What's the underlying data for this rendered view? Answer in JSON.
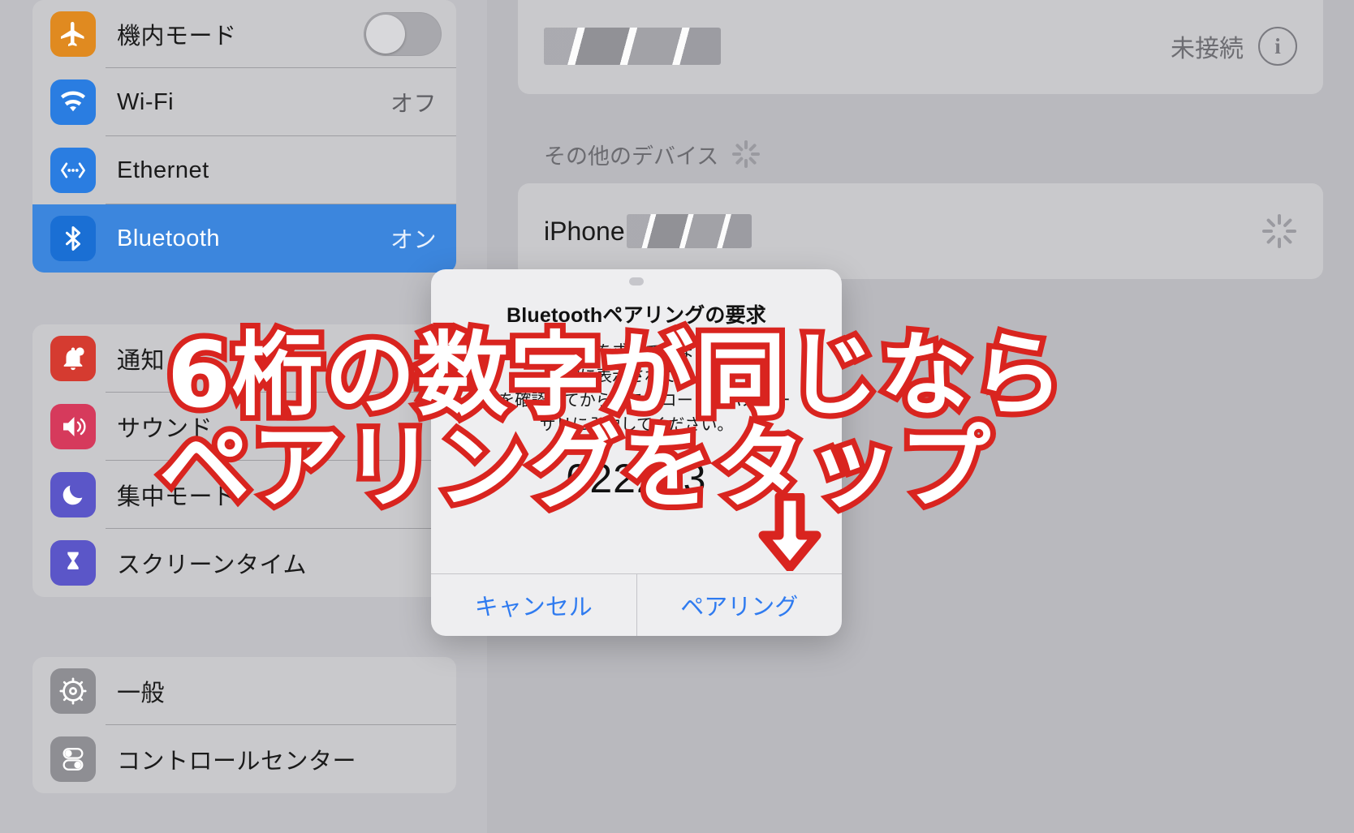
{
  "app": {
    "name": "iPadOS Settings",
    "accent_blue": "#3c86dd",
    "annotation_red": "#d9241f"
  },
  "sidebar": {
    "groups": [
      {
        "name": "connectivity",
        "items": [
          {
            "label": "機内モード",
            "icon": "airplane-icon",
            "control": "toggle",
            "toggle_on": false,
            "value": ""
          },
          {
            "label": "Wi-Fi",
            "icon": "wifi-icon",
            "control": "value",
            "value": "オフ"
          },
          {
            "label": "Ethernet",
            "icon": "ethernet-icon",
            "control": "none",
            "value": ""
          },
          {
            "label": "Bluetooth",
            "icon": "bluetooth-icon",
            "control": "value",
            "value": "オン",
            "selected": true
          }
        ]
      },
      {
        "name": "system-prefs",
        "items": [
          {
            "label": "通知",
            "icon": "bell-icon",
            "control": "none",
            "value": ""
          },
          {
            "label": "サウンド",
            "icon": "speaker-icon",
            "control": "none",
            "value": ""
          },
          {
            "label": "集中モード",
            "icon": "moon-icon",
            "control": "none",
            "value": ""
          },
          {
            "label": "スクリーンタイム",
            "icon": "hourglass-icon",
            "control": "none",
            "value": ""
          }
        ]
      },
      {
        "name": "general",
        "items": [
          {
            "label": "一般",
            "icon": "gear-icon",
            "control": "none",
            "value": ""
          },
          {
            "label": "コントロールセンター",
            "icon": "control-center-icon",
            "control": "none",
            "value": ""
          }
        ]
      }
    ]
  },
  "detail": {
    "paired_device": {
      "name_redacted": true,
      "status": "未接続",
      "info_glyph": "i"
    },
    "other_devices_header": "その他のデバイス",
    "other_devices": [
      {
        "name": "iPhone",
        "name_suffix_redacted": true,
        "scanning": true
      }
    ]
  },
  "dialog": {
    "title": "Bluetoothペアリングの要求",
    "body_line1": "がペアリングを求めています。コード",
    "body_line2": "が\" \"に表示されているこ",
    "body_line3": "とを確認してから、このコードをパスキー",
    "body_line4": "サリに入力してください。",
    "pairing_code": "022253",
    "cancel_label": "キャンセル",
    "pair_label": "ペアリング"
  },
  "annotation": {
    "line1": "6桁の数字が同じなら",
    "line2": "ペアリングをタップ",
    "arrow": "down-arrow"
  }
}
